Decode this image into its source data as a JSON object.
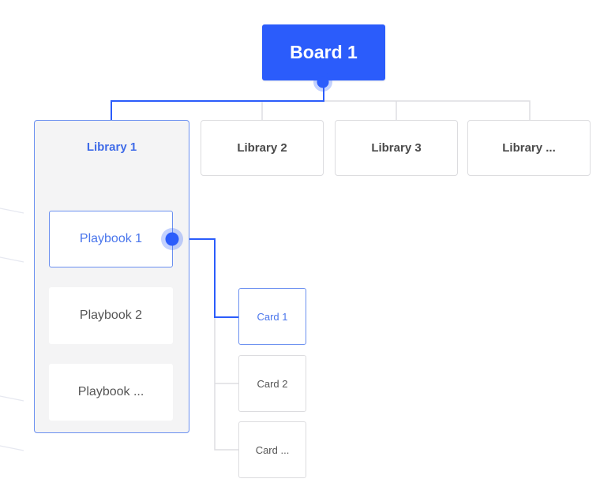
{
  "diagram": {
    "board": {
      "label": "Board 1"
    },
    "libraries": [
      {
        "label": "Library 1",
        "active": true
      },
      {
        "label": "Library 2",
        "active": false
      },
      {
        "label": "Library 3",
        "active": false
      },
      {
        "label": "Library ...",
        "active": false
      }
    ],
    "playbooks": [
      {
        "label": "Playbook 1",
        "active": true
      },
      {
        "label": "Playbook 2",
        "active": false
      },
      {
        "label": "Playbook ...",
        "active": false
      }
    ],
    "cards": [
      {
        "label": "Card 1",
        "active": true
      },
      {
        "label": "Card 2",
        "active": false
      },
      {
        "label": "Card ...",
        "active": false
      }
    ],
    "colors": {
      "accent": "#2b5cfb",
      "active_border": "#6b90f0",
      "active_text": "#4a76ec",
      "inactive_border": "#dcdcdf",
      "inactive_text": "#4a4a4a",
      "container_fill": "#f4f4f5",
      "connector_active": "#2b5cfb",
      "connector_inactive": "#dedee2"
    }
  }
}
